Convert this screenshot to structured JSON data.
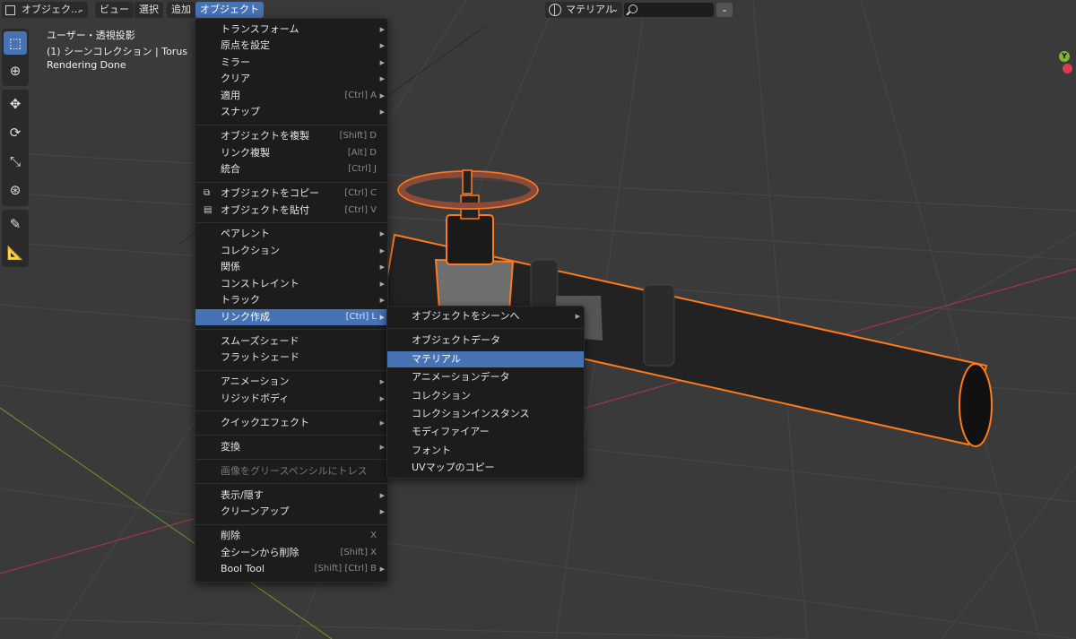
{
  "header": {
    "mode": "オブジェク…",
    "menus": [
      "ビュー",
      "選択",
      "追加",
      "オブジェクト"
    ],
    "link_mode": "マテリアル",
    "search_value": ""
  },
  "viewport": {
    "overlay": [
      "ユーザー・透視投影",
      "(1) シーンコレクション | Torus",
      "Rendering Done"
    ],
    "gizmo_y_label": "Y"
  },
  "toolbar": {
    "icons": [
      "select-box-icon",
      "cursor-icon",
      "move-icon",
      "rotate-icon",
      "scale-icon",
      "transform-icon",
      "annotate-icon",
      "measure-icon"
    ]
  },
  "object_menu": {
    "items": [
      {
        "label": "トランスフォーム",
        "shortcut": "",
        "submenu": true
      },
      {
        "label": "原点を設定",
        "shortcut": "",
        "submenu": true
      },
      {
        "label": "ミラー",
        "shortcut": "",
        "submenu": true
      },
      {
        "label": "クリア",
        "shortcut": "",
        "submenu": true
      },
      {
        "label": "適用",
        "shortcut": "[Ctrl] A",
        "submenu": true
      },
      {
        "label": "スナップ",
        "shortcut": "",
        "submenu": true
      },
      {
        "label": "オブジェクトを複製",
        "shortcut": "[Shift] D",
        "submenu": false
      },
      {
        "label": "リンク複製",
        "shortcut": "[Alt] D",
        "submenu": false
      },
      {
        "label": "統合",
        "shortcut": "[Ctrl] J",
        "submenu": false
      },
      {
        "label": "オブジェクトをコピー",
        "shortcut": "[Ctrl] C",
        "submenu": false
      },
      {
        "label": "オブジェクトを貼付",
        "shortcut": "[Ctrl] V",
        "submenu": false
      },
      {
        "label": "ペアレント",
        "shortcut": "",
        "submenu": true
      },
      {
        "label": "コレクション",
        "shortcut": "",
        "submenu": true
      },
      {
        "label": "関係",
        "shortcut": "",
        "submenu": true
      },
      {
        "label": "コンストレイント",
        "shortcut": "",
        "submenu": true
      },
      {
        "label": "トラック",
        "shortcut": "",
        "submenu": true
      },
      {
        "label": "リンク作成",
        "shortcut": "[Ctrl] L",
        "submenu": true
      },
      {
        "label": "スムーズシェード",
        "shortcut": "",
        "submenu": false
      },
      {
        "label": "フラットシェード",
        "shortcut": "",
        "submenu": false
      },
      {
        "label": "アニメーション",
        "shortcut": "",
        "submenu": true
      },
      {
        "label": "リジッドボディ",
        "shortcut": "",
        "submenu": true
      },
      {
        "label": "クイックエフェクト",
        "shortcut": "",
        "submenu": true
      },
      {
        "label": "変換",
        "shortcut": "",
        "submenu": true
      },
      {
        "label": "画像をグリースペンシルにトレス",
        "shortcut": "",
        "submenu": false
      },
      {
        "label": "表示/隠す",
        "shortcut": "",
        "submenu": true
      },
      {
        "label": "クリーンアップ",
        "shortcut": "",
        "submenu": true
      },
      {
        "label": "削除",
        "shortcut": "X",
        "submenu": false
      },
      {
        "label": "全シーンから削除",
        "shortcut": "[Shift] X",
        "submenu": false
      },
      {
        "label": "Bool Tool",
        "shortcut": "[Shift] [Ctrl] B",
        "submenu": true
      }
    ]
  },
  "link_submenu": {
    "items": [
      {
        "label": "オブジェクトをシーンへ",
        "submenu": true
      },
      {
        "label": "オブジェクトデータ",
        "submenu": false
      },
      {
        "label": "マテリアル",
        "submenu": false
      },
      {
        "label": "アニメーションデータ",
        "submenu": false
      },
      {
        "label": "コレクション",
        "submenu": false
      },
      {
        "label": "コレクションインスタンス",
        "submenu": false
      },
      {
        "label": "モディファイアー",
        "submenu": false
      },
      {
        "label": "フォント",
        "submenu": false
      },
      {
        "label": "UVマップのコピー",
        "submenu": false
      }
    ]
  },
  "colors": {
    "accent": "#4772b3",
    "selection_outline": "#ff7a1a",
    "axis_x": "#e03a4e",
    "axis_y": "#7fb236"
  }
}
